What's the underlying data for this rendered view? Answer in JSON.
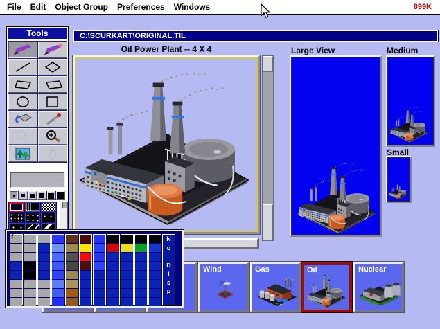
{
  "menu": {
    "items": [
      {
        "label": "File"
      },
      {
        "label": "Edit"
      },
      {
        "label": "Object Group"
      },
      {
        "label": "Preferences"
      },
      {
        "label": "Windows"
      }
    ],
    "memory": "899K"
  },
  "document": {
    "path": "C:\\SCURKART\\ORIGINAL.TIL"
  },
  "editor": {
    "title": "Oil Power Plant -- 4 X 4"
  },
  "panels": {
    "large": {
      "label": "Large View"
    },
    "medium": {
      "label": "Medium"
    },
    "small": {
      "label": "Small"
    }
  },
  "tools": {
    "title": "Tools",
    "buttons": [
      {
        "icon": "pencil-icon",
        "selected": true
      },
      {
        "icon": "eraser-icon"
      },
      {
        "icon": "line-icon"
      },
      {
        "icon": "diamond-icon"
      },
      {
        "icon": "quadrilateral-left-icon"
      },
      {
        "icon": "quadrilateral-right-icon"
      },
      {
        "icon": "ellipse-icon"
      },
      {
        "icon": "rectangle-icon"
      },
      {
        "icon": "paint-bucket-icon"
      },
      {
        "icon": "dropper-icon"
      },
      {
        "icon": "spray-icon",
        "disabled": true
      },
      {
        "icon": "zoom-in-icon"
      },
      {
        "icon": "trees-icon"
      },
      {
        "icon": "flame-icon",
        "disabled": true
      }
    ]
  },
  "brush_sizes": [
    {
      "size": 3,
      "selected": true
    },
    {
      "size": 5
    },
    {
      "size": 6
    },
    {
      "size": 7
    },
    {
      "size": 9
    },
    {
      "size": 11
    }
  ],
  "patterns": [
    {
      "name": "solid",
      "selected": true
    },
    {
      "name": "dither-fine"
    },
    {
      "name": "checker"
    },
    {
      "name": "dots-dense"
    },
    {
      "name": "dots-medium"
    },
    {
      "name": "dots-sparse"
    },
    {
      "name": "dots-rare"
    },
    {
      "name": "stripes-thin"
    },
    {
      "name": "stripes-thick"
    }
  ],
  "palette": {
    "marker": "f",
    "no_disp": "N\no\n\nD\ni\ns\np",
    "columns": [
      [
        "#a8a8a8",
        "#a8a8a8",
        "#a8a8a8",
        "#0b23b5",
        "#0b23b5",
        "#a8a8a8",
        "#a8a8a8",
        "#a8a8a8"
      ],
      [
        "#a8a8a8",
        "#a8a8a8",
        "#a8a8a8",
        "#000000",
        "#000000",
        "#a8a8a8",
        "#a8a8a8",
        "#a8a8a8"
      ],
      [
        "#a8a8a8",
        "#0b23b5",
        "#0b23b5",
        "#0b23b5",
        "#0b23b5",
        "#a8a8a8",
        "#a8a8a8",
        "#a8a8a8"
      ],
      [
        "#2836ff",
        "#6e95fa",
        "#4a6cfa",
        "#3c58f6",
        "#2f46f2",
        "#5a7ef6",
        "#4160f2",
        "#1f2dfb"
      ],
      [
        "#5f3317",
        "#9f8c4b",
        "#53534b",
        "#47473f",
        "#9b884f",
        "#a7945f",
        "#a35b13",
        "#8f5b23"
      ],
      [
        "#470f07",
        "#f7e707",
        "#fb0707",
        "#470f07",
        "#0b23b5",
        "#0b23b5",
        "#0b23b5",
        "#0b23b5"
      ],
      [
        "#2333f7",
        "#2b43fb",
        "#2337f3",
        "#2b43fb",
        "#0b23b5",
        "#0b23b5",
        "#0b23b5",
        "#0b23b5"
      ],
      [
        "#000000",
        "#cf0707",
        "#0b23b5",
        "#0b23b5",
        "#0b23b5",
        "#0b23b5",
        "#0b23b5",
        "#0b23b5"
      ],
      [
        "#000000",
        "#e7df23",
        "#0b23b5",
        "#0b23b5",
        "#0b23b5",
        "#0b23b5",
        "#0b23b5",
        "#0b23b5"
      ],
      [
        "#000000",
        "#0b9f23",
        "#0b23b5",
        "#0b23b5",
        "#0b23b5",
        "#0b23b5",
        "#0b23b5",
        "#0b23b5"
      ],
      [
        "#000000",
        "#1737cb",
        "#0b23b5",
        "#0b23b5",
        "#0b23b5",
        "#0b23b5",
        "#0b23b5",
        "#0b23b5"
      ]
    ]
  },
  "tiles": [
    {
      "label": "",
      "covered": true
    },
    {
      "label": "",
      "covered": true
    },
    {
      "label": "",
      "covered": true
    },
    {
      "label": "Wind",
      "sprite": "wind"
    },
    {
      "label": "Gas",
      "sprite": "gas"
    },
    {
      "label": "Oil",
      "sprite": "plant",
      "selected": true
    },
    {
      "label": "Nuclear",
      "sprite": "nuclear"
    }
  ],
  "colors": {
    "desktop": "#b6baf2",
    "menubar_bg": "#ffffff",
    "memory_text": "#b40000",
    "titlebar_bg": "#00008c",
    "canvas_blue": "#0202f0",
    "canvas_border_yellow": "#dcc83c",
    "tile_blue": "#5b68ee",
    "selection_red": "#9c0a0a",
    "palette_bg": "#000080",
    "tools_title_bg": "#0e0ea0"
  }
}
